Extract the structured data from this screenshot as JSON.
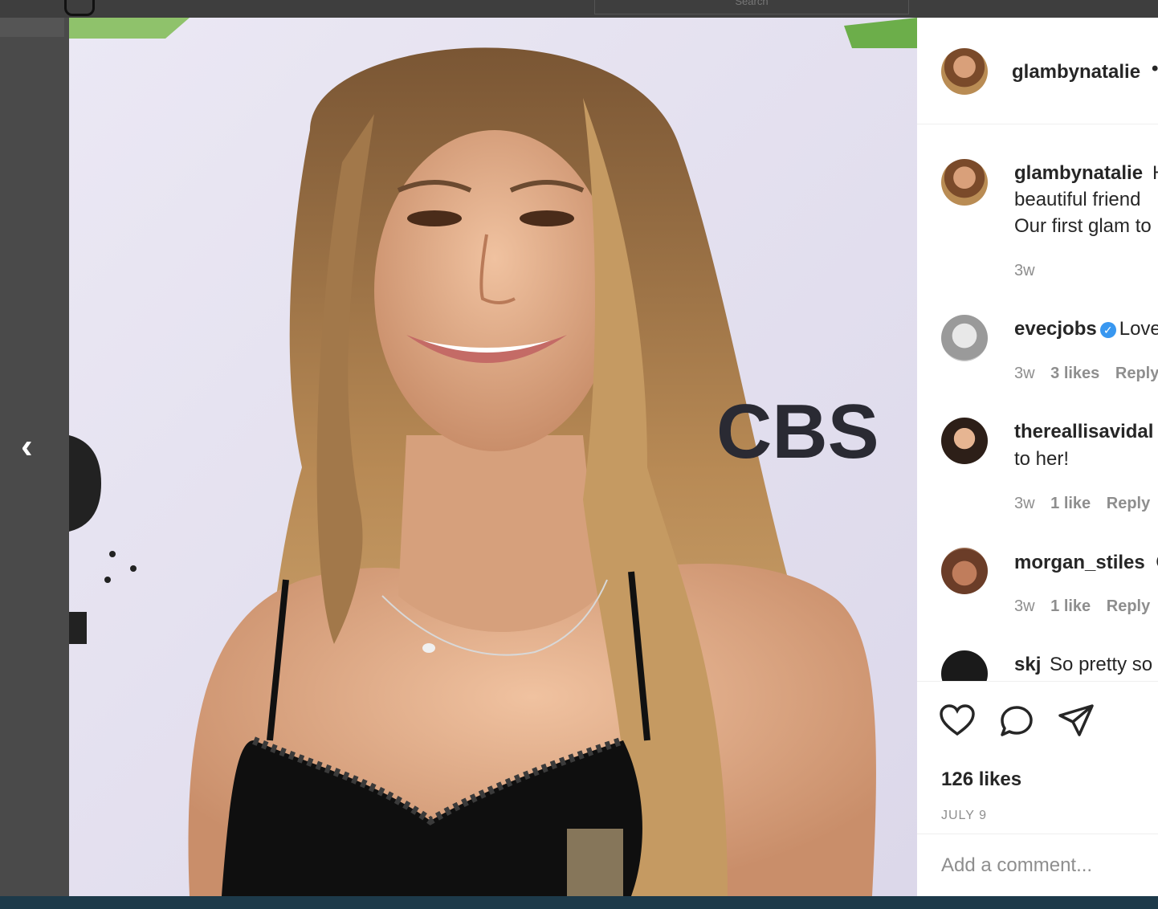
{
  "header": {
    "search_placeholder": "Search"
  },
  "post": {
    "author": "glambynatalie",
    "author_dot": "•",
    "likes": "126 likes",
    "date": "JULY 9",
    "add_comment_placeholder": "Add a comment...",
    "photo_sign_text": "CBS"
  },
  "comments": [
    {
      "user": "glambynatalie",
      "lines": [
        "beautiful friend",
        "Our first glam to"
      ],
      "first_text": "H",
      "time": "3w",
      "likes": "",
      "reply": ""
    },
    {
      "user": "evecjobs",
      "verified": true,
      "text": "Love",
      "time": "3w",
      "likes": "3 likes",
      "reply": "Reply"
    },
    {
      "user": "thereallisavidal",
      "text": "to her!",
      "time": "3w",
      "likes": "1 like",
      "reply": "Reply"
    },
    {
      "user": "morgan_stiles",
      "text": "😍",
      "time": "3w",
      "likes": "1 like",
      "reply": "Reply"
    },
    {
      "user": "skj",
      "text": "So pretty so"
    }
  ],
  "icons": {
    "prev": "chevron-left-icon",
    "like": "heart-icon",
    "comment": "comment-bubble-icon",
    "share": "paper-plane-icon"
  },
  "colors": {
    "link_blue": "#3897f0",
    "muted_text": "#8e8e8e",
    "text": "#262626"
  }
}
